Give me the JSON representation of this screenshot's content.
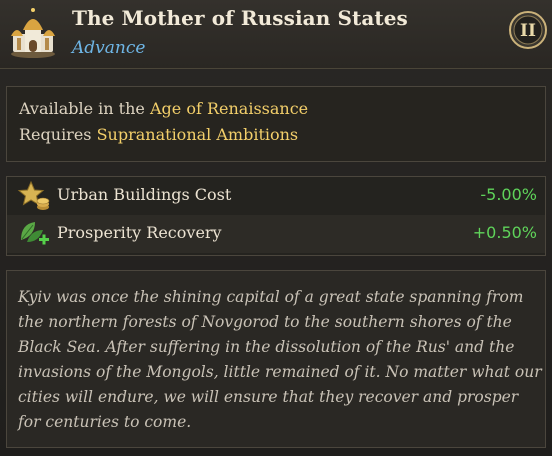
{
  "header": {
    "title": "The Mother of Russian States",
    "subtitle": "Advance",
    "tier": "II",
    "icon": "building-icon"
  },
  "requirements": {
    "line1_prefix": "Available in the ",
    "line1_value": "Age of Renaissance",
    "line2_prefix": "Requires ",
    "line2_value": "Supranational Ambitions"
  },
  "modifiers": [
    {
      "icon": "star-coins-icon",
      "label": "Urban Buildings Cost",
      "value": "-5.00%"
    },
    {
      "icon": "leaf-plus-icon",
      "label": "Prosperity Recovery",
      "value": "+0.50%"
    }
  ],
  "description": "Kyiv was once the shining capital of a great state spanning from the northern forests of Novgorod to the southern shores of the Black Sea. After suffering in the dissolution of the Rus' and the invasions of the Mongols, little remained of it. No matter what our cities will endure, we will ensure that they recover and prosper for centuries to come.",
  "colors": {
    "highlight": "#f3cf6a",
    "positive": "#5fd35a",
    "subtitle": "#6fb6e6"
  }
}
